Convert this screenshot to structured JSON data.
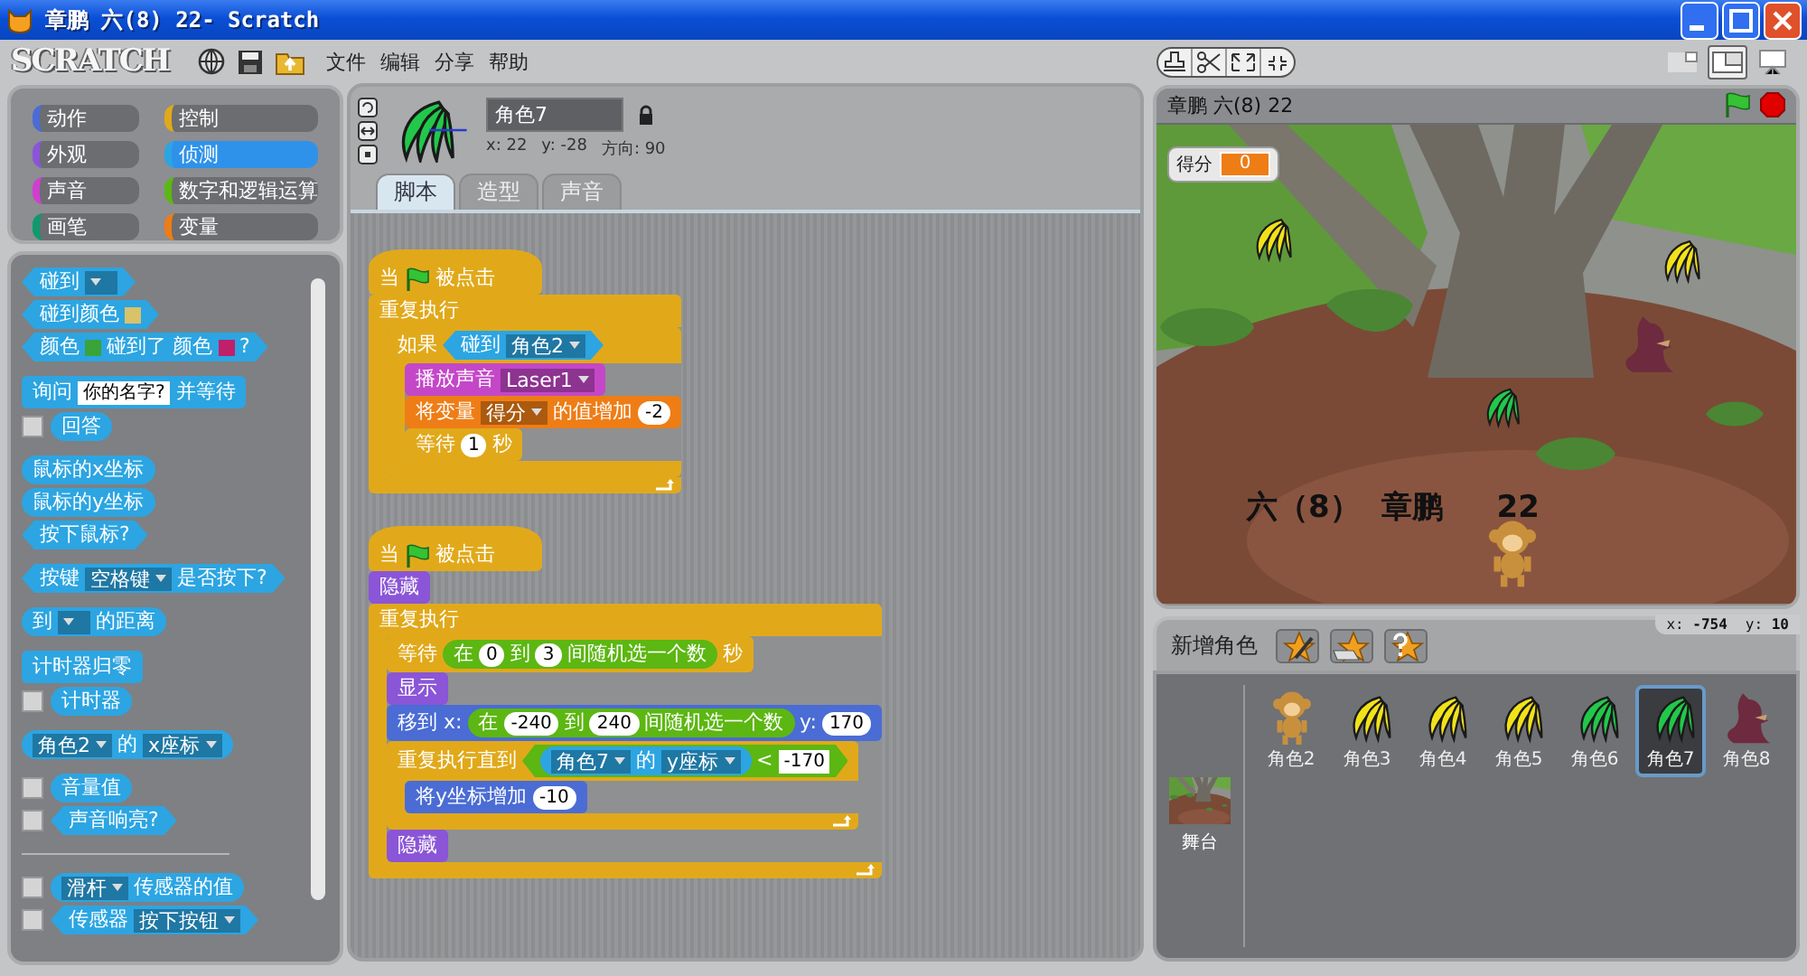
{
  "window": {
    "title": "章鹏 六(8) 22- Scratch"
  },
  "logo": "SCRATCH",
  "menu": [
    "文件",
    "编辑",
    "分享",
    "帮助"
  ],
  "view_modes": [
    {
      "kind": "small",
      "selected": false
    },
    {
      "kind": "normal",
      "selected": true
    },
    {
      "kind": "presentation",
      "selected": false
    }
  ],
  "categories": [
    {
      "label": "动作",
      "color": "#4a6cd4",
      "selected": false
    },
    {
      "label": "控制",
      "color": "#e1a91a",
      "selected": false
    },
    {
      "label": "外观",
      "color": "#8a55d7",
      "selected": false
    },
    {
      "label": "侦测",
      "color": "#2ca5e2",
      "selected": true
    },
    {
      "label": "声音",
      "color": "#cf3fd0",
      "selected": false
    },
    {
      "label": "数字和逻辑运算",
      "color": "#5cb712",
      "selected": false
    },
    {
      "label": "画笔",
      "color": "#0e9a6c",
      "selected": false
    },
    {
      "label": "变量",
      "color": "#ee7d16",
      "selected": false
    }
  ],
  "palette": [
    [
      {
        "kind": "boolean",
        "color": "#2ca5e2",
        "parts": [
          {
            "kind": "text",
            "text": "碰到"
          },
          {
            "kind": "dropdown"
          }
        ]
      },
      {
        "kind": "boolean",
        "color": "#2ca5e2",
        "parts": [
          {
            "kind": "text",
            "text": "碰到颜色"
          },
          {
            "kind": "color",
            "color": "#d8c26a"
          }
        ]
      },
      {
        "kind": "boolean",
        "color": "#2ca5e2",
        "parts": [
          {
            "kind": "text",
            "text": "颜色"
          },
          {
            "kind": "color",
            "color": "#3aa33a"
          },
          {
            "kind": "text",
            "text": "碰到了 颜色"
          },
          {
            "kind": "color",
            "color": "#c0206a"
          },
          {
            "kind": "text",
            "text": "?"
          }
        ]
      }
    ],
    [
      {
        "kind": "command",
        "color": "#2ca5e2",
        "parts": [
          {
            "kind": "text",
            "text": "询问"
          },
          {
            "kind": "string",
            "text": "你的名字?"
          },
          {
            "kind": "text",
            "text": "并等待"
          }
        ]
      },
      {
        "kind": "reporter",
        "color": "#2ca5e2",
        "checked": false,
        "parts": [
          {
            "kind": "text",
            "text": "回答"
          }
        ]
      }
    ],
    [
      {
        "kind": "reporter",
        "color": "#2ca5e2",
        "parts": [
          {
            "kind": "text",
            "text": "鼠标的x坐标"
          }
        ]
      },
      {
        "kind": "reporter",
        "color": "#2ca5e2",
        "parts": [
          {
            "kind": "text",
            "text": "鼠标的y坐标"
          }
        ]
      },
      {
        "kind": "boolean",
        "color": "#2ca5e2",
        "parts": [
          {
            "kind": "text",
            "text": "按下鼠标?"
          }
        ]
      }
    ],
    [
      {
        "kind": "boolean",
        "color": "#2ca5e2",
        "parts": [
          {
            "kind": "text",
            "text": "按键"
          },
          {
            "kind": "dropdown",
            "text": "空格键"
          },
          {
            "kind": "text",
            "text": "是否按下?"
          }
        ]
      }
    ],
    [
      {
        "kind": "reporter",
        "color": "#2ca5e2",
        "parts": [
          {
            "kind": "text",
            "text": "到"
          },
          {
            "kind": "dropdown"
          },
          {
            "kind": "text",
            "text": "的距离"
          }
        ]
      }
    ],
    [
      {
        "kind": "command",
        "color": "#2ca5e2",
        "parts": [
          {
            "kind": "text",
            "text": "计时器归零"
          }
        ]
      },
      {
        "kind": "reporter",
        "color": "#2ca5e2",
        "checked": false,
        "parts": [
          {
            "kind": "text",
            "text": "计时器"
          }
        ]
      }
    ],
    [
      {
        "kind": "reporter",
        "color": "#2ca5e2",
        "parts": [
          {
            "kind": "dropdown",
            "text": "角色2"
          },
          {
            "kind": "text",
            "text": "的"
          },
          {
            "kind": "dropdown",
            "text": "x座标"
          }
        ]
      }
    ],
    [
      {
        "kind": "reporter",
        "color": "#2ca5e2",
        "checked": false,
        "parts": [
          {
            "kind": "text",
            "text": "音量值"
          }
        ]
      },
      {
        "kind": "boolean",
        "color": "#2ca5e2",
        "checked": false,
        "parts": [
          {
            "kind": "text",
            "text": "声音响亮?"
          }
        ]
      }
    ]
  ],
  "sensor_blocks": [
    {
      "kind": "reporter",
      "color": "#2ca5e2",
      "checked": false,
      "parts": [
        {
          "kind": "dropdown",
          "text": "滑杆"
        },
        {
          "kind": "text",
          "text": "传感器的值"
        }
      ]
    },
    {
      "kind": "boolean",
      "color": "#2ca5e2",
      "checked": false,
      "parts": [
        {
          "kind": "text",
          "text": "传感器"
        },
        {
          "kind": "dropdown",
          "text": "按下按钮"
        }
      ]
    }
  ],
  "sprite": {
    "name": "角色7",
    "x": "x: 22",
    "y": "y: -28",
    "direction": "方向: 90"
  },
  "tabs": [
    {
      "label": "脚本",
      "selected": true
    },
    {
      "label": "造型",
      "selected": false
    },
    {
      "label": "声音",
      "selected": false
    }
  ],
  "scripts": [
    [
      {
        "kind": "hat",
        "color": "#e1a91a",
        "parts": [
          {
            "kind": "text",
            "text": "当"
          },
          {
            "kind": "flag"
          },
          {
            "kind": "text",
            "text": "被点击"
          }
        ]
      },
      {
        "kind": "c",
        "color": "#e1a91a",
        "arrow": true,
        "parts": [
          {
            "kind": "text",
            "text": "重复执行"
          }
        ],
        "children": [
          {
            "kind": "c",
            "color": "#e1a91a",
            "arrow": false,
            "parts": [
              {
                "kind": "text",
                "text": "如果"
              },
              {
                "kind": "boolean",
                "color": "#2ca5e2",
                "parts": [
                  {
                    "kind": "text",
                    "text": "碰到"
                  },
                  {
                    "kind": "dropdown",
                    "text": "角色2"
                  }
                ]
              }
            ],
            "children": [
              {
                "kind": "command",
                "color": "#c447c8",
                "parts": [
                  {
                    "kind": "text",
                    "text": "播放声音"
                  },
                  {
                    "kind": "dropdown",
                    "text": "Laser1"
                  }
                ]
              },
              {
                "kind": "command",
                "color": "#ee7d16",
                "parts": [
                  {
                    "kind": "text",
                    "text": "将变量"
                  },
                  {
                    "kind": "dropdown",
                    "text": "得分"
                  },
                  {
                    "kind": "text",
                    "text": "的值增加"
                  },
                  {
                    "kind": "number",
                    "text": "-2"
                  }
                ]
              },
              {
                "kind": "command",
                "color": "#e1a91a",
                "parts": [
                  {
                    "kind": "text",
                    "text": "等待"
                  },
                  {
                    "kind": "number",
                    "text": "1"
                  },
                  {
                    "kind": "text",
                    "text": "秒"
                  }
                ]
              }
            ]
          }
        ]
      }
    ],
    [
      {
        "kind": "hat",
        "color": "#e1a91a",
        "parts": [
          {
            "kind": "text",
            "text": "当"
          },
          {
            "kind": "flag"
          },
          {
            "kind": "text",
            "text": "被点击"
          }
        ]
      },
      {
        "kind": "command",
        "color": "#8a55d7",
        "parts": [
          {
            "kind": "text",
            "text": "隐藏"
          }
        ]
      },
      {
        "kind": "c",
        "color": "#e1a91a",
        "arrow": true,
        "parts": [
          {
            "kind": "text",
            "text": "重复执行"
          }
        ],
        "children": [
          {
            "kind": "command",
            "color": "#e1a91a",
            "parts": [
              {
                "kind": "text",
                "text": "等待"
              },
              {
                "kind": "reporter",
                "color": "#5cb712",
                "parts": [
                  {
                    "kind": "text",
                    "text": "在"
                  },
                  {
                    "kind": "number",
                    "text": "0"
                  },
                  {
                    "kind": "text",
                    "text": "到"
                  },
                  {
                    "kind": "number",
                    "text": "3"
                  },
                  {
                    "kind": "text",
                    "text": "间随机选一个数"
                  }
                ]
              },
              {
                "kind": "text",
                "text": "秒"
              }
            ]
          },
          {
            "kind": "command",
            "color": "#8a55d7",
            "parts": [
              {
                "kind": "text",
                "text": "显示"
              }
            ]
          },
          {
            "kind": "command",
            "color": "#4a6cd4",
            "parts": [
              {
                "kind": "text",
                "text": "移到 x:"
              },
              {
                "kind": "reporter",
                "color": "#5cb712",
                "parts": [
                  {
                    "kind": "text",
                    "text": "在"
                  },
                  {
                    "kind": "number",
                    "text": "-240"
                  },
                  {
                    "kind": "text",
                    "text": "到"
                  },
                  {
                    "kind": "number",
                    "text": "240"
                  },
                  {
                    "kind": "text",
                    "text": "间随机选一个数"
                  }
                ]
              },
              {
                "kind": "text",
                "text": "y:"
              },
              {
                "kind": "number",
                "text": "170"
              }
            ]
          },
          {
            "kind": "c",
            "color": "#e1a91a",
            "arrow": true,
            "parts": [
              {
                "kind": "text",
                "text": "重复执行直到"
              },
              {
                "kind": "boolean",
                "color": "#5cb712",
                "parts": [
                  {
                    "kind": "reporter",
                    "color": "#2ca5e2",
                    "parts": [
                      {
                        "kind": "dropdown",
                        "text": "角色7"
                      },
                      {
                        "kind": "text",
                        "text": "的"
                      },
                      {
                        "kind": "dropdown",
                        "text": "y座标"
                      }
                    ]
                  },
                  {
                    "kind": "text",
                    "text": "<"
                  },
                  {
                    "kind": "string",
                    "text": "-170"
                  }
                ]
              }
            ],
            "children": [
              {
                "kind": "command",
                "color": "#4a6cd4",
                "parts": [
                  {
                    "kind": "text",
                    "text": "将y坐标增加"
                  },
                  {
                    "kind": "number",
                    "text": "-10"
                  }
                ]
              }
            ]
          },
          {
            "kind": "command",
            "color": "#8a55d7",
            "parts": [
              {
                "kind": "text",
                "text": "隐藏"
              }
            ]
          }
        ]
      }
    ]
  ],
  "stage": {
    "title": "章鹏 六(8) 22",
    "monitor": {
      "label": "得分",
      "value": "0"
    },
    "caption": "六（8）  章鹏     22"
  },
  "mouse": {
    "x": "x: **-754**",
    "y": "y: **10**"
  },
  "new_sprite": {
    "label": "新增角色"
  },
  "stage_thumb": {
    "label": "舞台"
  },
  "sprites": [
    {
      "name": "角色2",
      "kind": "monkey",
      "color": "#c8903c",
      "selected": false
    },
    {
      "name": "角色3",
      "kind": "banana",
      "color": "#f2e21a",
      "selected": false
    },
    {
      "name": "角色4",
      "kind": "banana",
      "color": "#f2e21a",
      "selected": false
    },
    {
      "name": "角色5",
      "kind": "banana",
      "color": "#f2e21a",
      "selected": false
    },
    {
      "name": "角色6",
      "kind": "banana",
      "color": "#22c84a",
      "selected": false
    },
    {
      "name": "角色7",
      "kind": "banana",
      "color": "#22c84a",
      "selected": true
    },
    {
      "name": "角色8",
      "kind": "creature",
      "color": "#6e2a3e",
      "selected": false
    }
  ]
}
